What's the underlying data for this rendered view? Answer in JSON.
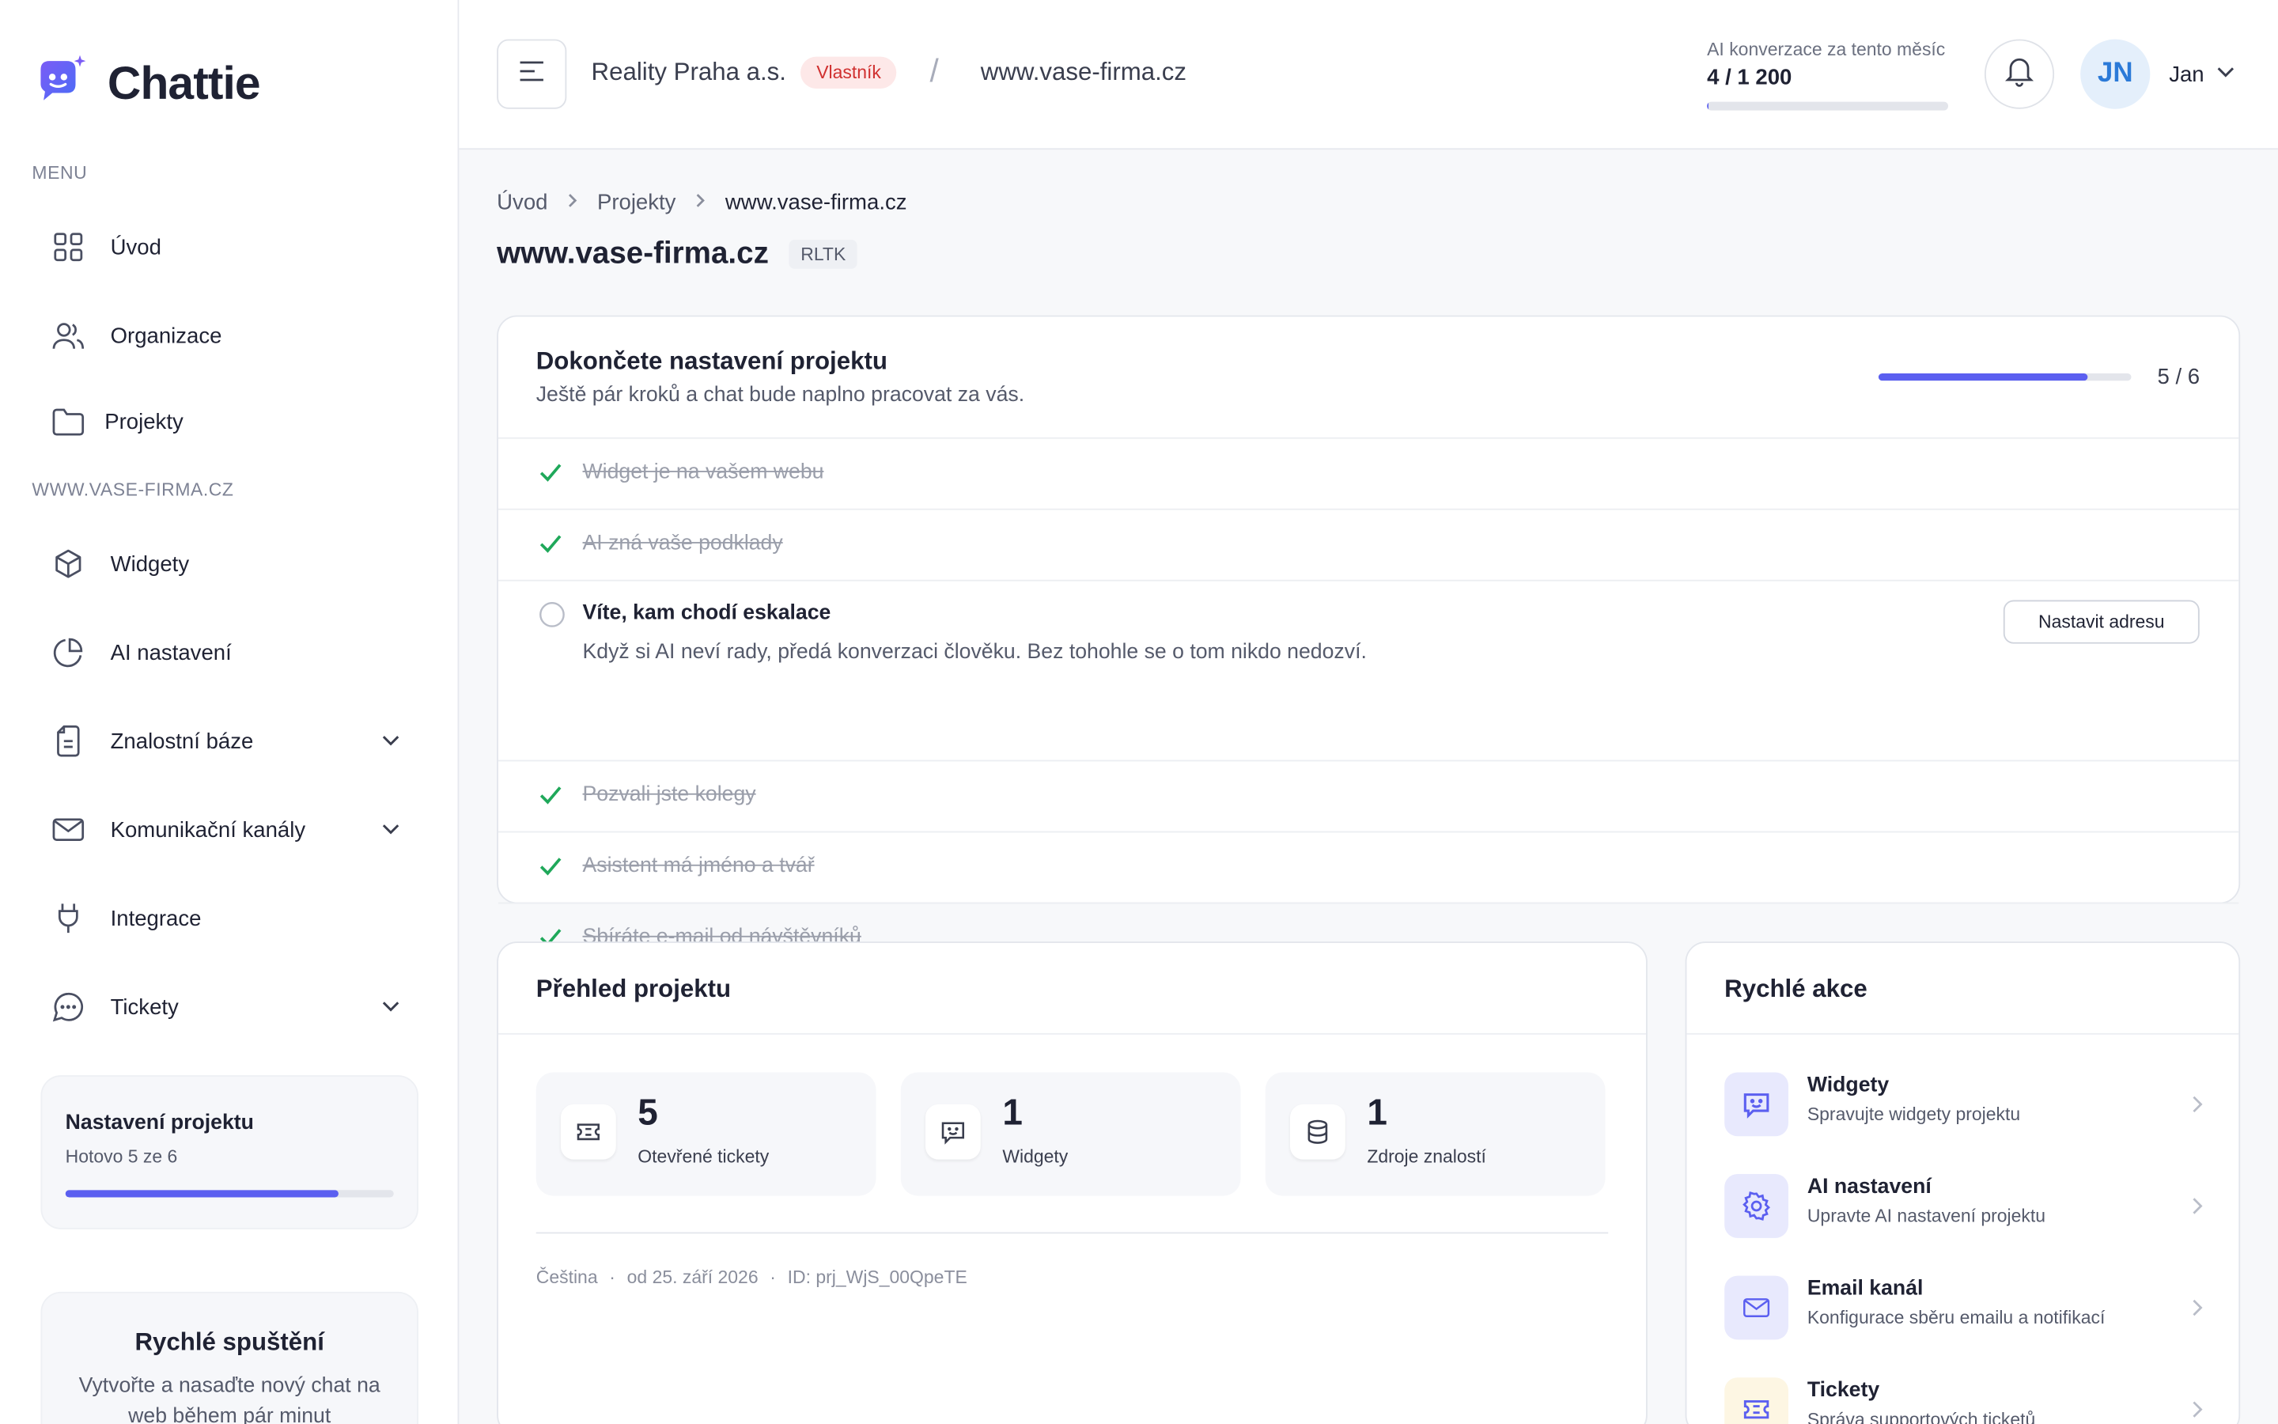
{
  "app": {
    "name": "Chattie"
  },
  "sidebar": {
    "menu_label": "MENU",
    "menu_items": [
      {
        "label": "Úvod",
        "icon": "grid-icon"
      },
      {
        "label": "Organizace",
        "icon": "users-icon"
      },
      {
        "label": "Projekty",
        "icon": "folder-icon"
      }
    ],
    "project_label": "WWW.VASE-FIRMA.CZ",
    "project_items": [
      {
        "label": "Widgety",
        "icon": "cube-icon"
      },
      {
        "label": "AI nastavení",
        "icon": "pie-chart-icon"
      },
      {
        "label": "Znalostní báze",
        "icon": "document-icon",
        "expandable": true
      },
      {
        "label": "Komunikační kanály",
        "icon": "mail-icon",
        "expandable": true
      },
      {
        "label": "Integrace",
        "icon": "plug-icon"
      },
      {
        "label": "Tickety",
        "icon": "chat-bubble-icon",
        "expandable": true
      }
    ],
    "setup_card": {
      "title": "Nastavení projektu",
      "subtitle": "Hotovo 5 ze 6",
      "progress": 0.83
    },
    "quick_start": {
      "title": "Rychlé spuštění",
      "text": "Vytvořte a nasaďte nový chat na web během pár minut"
    }
  },
  "header": {
    "organization": "Reality Praha a.s.",
    "role_badge": "Vlastník",
    "project": "www.vase-firma.cz",
    "usage_label": "AI konverzace za tento měsíc",
    "usage_value": "4 / 1 200",
    "usage_progress": 0.003,
    "avatar_initials": "JN",
    "user_name": "Jan"
  },
  "breadcrumb": [
    "Úvod",
    "Projekty",
    "www.vase-firma.cz"
  ],
  "page": {
    "title": "www.vase-firma.cz",
    "code": "RLTK"
  },
  "setup": {
    "title": "Dokončete nastavení projektu",
    "subtitle": "Ještě pár kroků a chat bude naplno pracovat za vás.",
    "progress": 0.83,
    "count": "5 / 6",
    "steps": [
      {
        "label": "Widget je na vašem webu",
        "done": true
      },
      {
        "label": "AI zná vaše podklady",
        "done": true
      },
      {
        "label": "Víte, kam chodí eskalace",
        "done": false,
        "description": "Když si AI neví rady, předá konverzaci člověku. Bez tohohle se o tom nikdo nedozví.",
        "action": "Nastavit adresu"
      },
      {
        "label": "Pozvali jste kolegy",
        "done": true
      },
      {
        "label": "Asistent má jméno a tvář",
        "done": true
      },
      {
        "label": "Sbíráte e-mail od návštěvníků",
        "done": true
      }
    ]
  },
  "overview": {
    "title": "Přehled projektu",
    "stats": [
      {
        "value": "5",
        "label": "Otevřené tickety",
        "icon": "ticket-icon"
      },
      {
        "value": "1",
        "label": "Widgety",
        "icon": "chat-widget-icon"
      },
      {
        "value": "1",
        "label": "Zdroje znalostí",
        "icon": "database-icon"
      }
    ],
    "meta": {
      "language": "Čeština",
      "created": "od 25. září 2026",
      "id": "ID: prj_WjS_00QpeTE",
      "sep": "·"
    }
  },
  "actions": {
    "title": "Rychlé akce",
    "items": [
      {
        "title": "Widgety",
        "subtitle": "Spravujte widgety projektu",
        "icon": "chat-widget-icon",
        "color": "#e8e9fd"
      },
      {
        "title": "AI nastavení",
        "subtitle": "Upravte AI nastavení projektu",
        "icon": "gear-icon",
        "color": "#e8e9fd"
      },
      {
        "title": "Email kanál",
        "subtitle": "Konfigurace sběru emailu a notifikací",
        "icon": "mail-icon",
        "color": "#e8e9fd"
      },
      {
        "title": "Tickety",
        "subtitle": "Správa supportových ticketů",
        "icon": "ticket-icon",
        "color": "#fdf6e3"
      }
    ]
  },
  "colors": {
    "accent": "#5b5ff0",
    "success": "#1fa85a",
    "danger": "#d0302f",
    "brand": "#5b5ff0"
  }
}
